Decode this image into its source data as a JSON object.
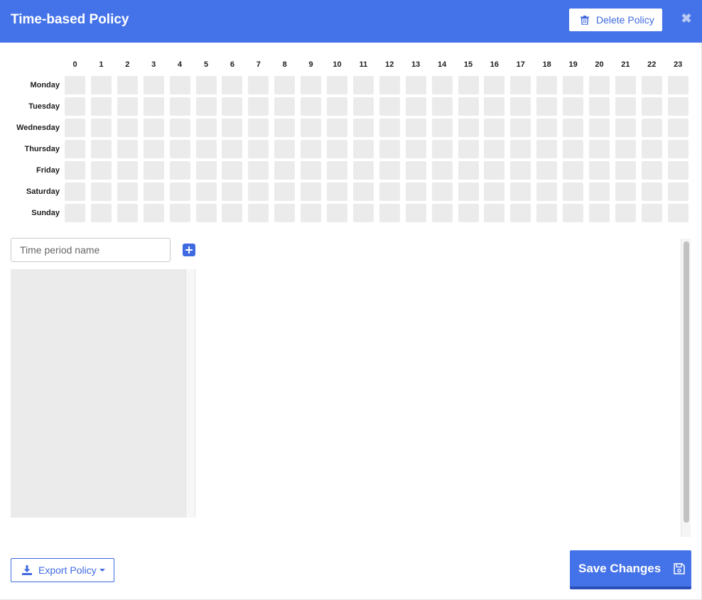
{
  "dialog": {
    "title": "Time-based Policy",
    "delete_label": "Delete Policy",
    "close_glyph": "✖"
  },
  "schedule": {
    "hours": [
      "0",
      "1",
      "2",
      "3",
      "4",
      "5",
      "6",
      "7",
      "8",
      "9",
      "10",
      "11",
      "12",
      "13",
      "14",
      "15",
      "16",
      "17",
      "18",
      "19",
      "20",
      "21",
      "22",
      "23"
    ],
    "days": [
      "Monday",
      "Tuesday",
      "Wednesday",
      "Thursday",
      "Friday",
      "Saturday",
      "Sunday"
    ]
  },
  "periods": {
    "input_placeholder": "Time period name",
    "input_value": ""
  },
  "footer": {
    "export_label": "Export Policy",
    "save_label": "Save Changes"
  },
  "icons": {
    "delete": "trash-icon",
    "close": "close-icon",
    "add": "plus-square-icon",
    "export": "download-icon",
    "save": "floppy-disk-icon"
  },
  "colors": {
    "accent": "#4472e8",
    "cell_empty": "#ebebeb"
  }
}
